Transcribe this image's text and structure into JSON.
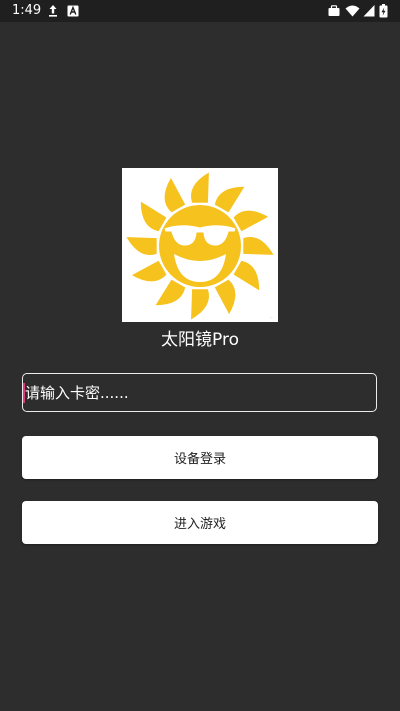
{
  "status_bar": {
    "time": "1:49",
    "left_icons": [
      "upload-icon",
      "font-app-icon"
    ],
    "right_icons": [
      "briefcase-icon",
      "wifi-icon",
      "signal-icon",
      "battery-charging-icon"
    ]
  },
  "logo": {
    "icon": "sun-with-sunglasses-logo",
    "sun_color": "#f6c21d",
    "background": "#ffffff"
  },
  "app": {
    "title": "太阳镜Pro"
  },
  "card_input": {
    "placeholder": "请输入卡密......",
    "value": ""
  },
  "buttons": {
    "device_login": "设备登录",
    "enter_game": "进入游戏"
  },
  "colors": {
    "background": "#2d2d2d",
    "status_bar": "#1f1f1f",
    "cursor": "#e0387b",
    "button_bg": "#ffffff"
  }
}
